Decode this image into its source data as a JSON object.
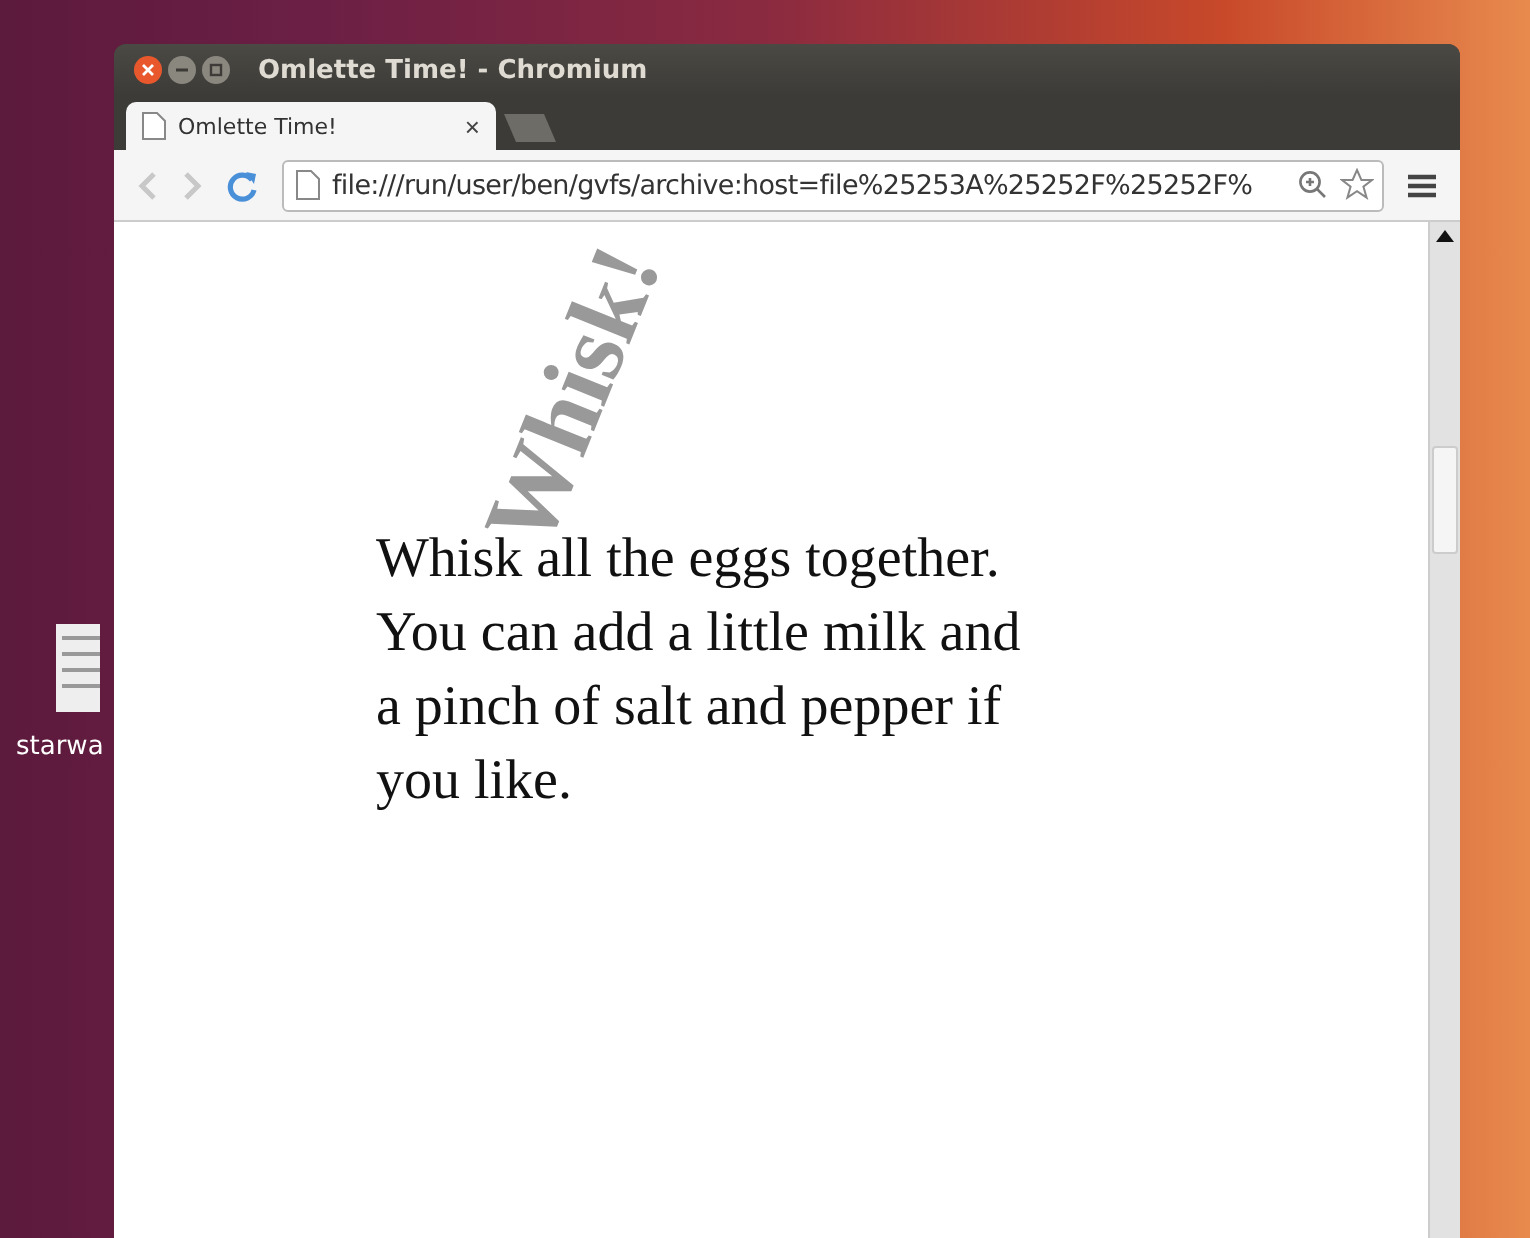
{
  "desktop": {
    "icons": [
      {
        "label": "starwa"
      }
    ]
  },
  "window": {
    "title": "Omlette Time! - Chromium"
  },
  "tabs": [
    {
      "label": "Omlette Time!",
      "selected": true,
      "close": "×"
    }
  ],
  "address_bar": {
    "value": "file:///run/user/ben/gvfs/archive:host=file%25253A%25252F%25252F%"
  },
  "page": {
    "rotated_heading": "Whisk!",
    "paragraph": "Whisk all the eggs together. You can add a little milk and a pinch of salt and pepper if you like."
  }
}
